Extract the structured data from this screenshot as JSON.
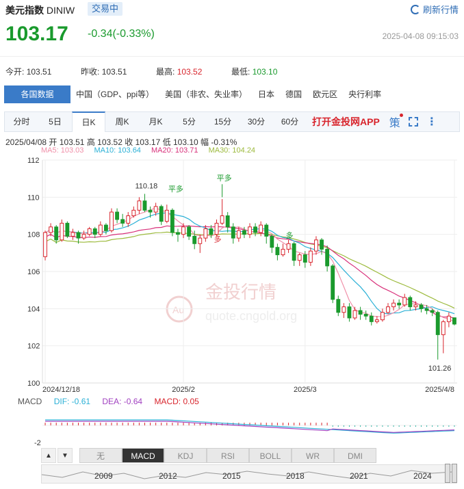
{
  "header": {
    "name": "美元指数",
    "code": "DINIW",
    "status_badge": "交易中",
    "refresh_label": "刷新行情",
    "price": "103.17",
    "change": "-0.34(-0.33%)",
    "timestamp": "2025-04-08 09:15:03"
  },
  "quote": {
    "open_label": "今开:",
    "open": "103.51",
    "prev_close_label": "昨收:",
    "prev_close": "103.51",
    "high_label": "最高:",
    "high": "103.52",
    "low_label": "最低:",
    "low": "103.10"
  },
  "data_tabs": [
    "各国数据",
    "中国（GDP、ppi等）",
    "美国（非农、失业率）",
    "日本",
    "德国",
    "欧元区",
    "央行利率"
  ],
  "period_tabs": [
    "分时",
    "5日",
    "日K",
    "周K",
    "月K",
    "5分",
    "15分",
    "30分",
    "60分"
  ],
  "period_active": "日K",
  "app_link": "打开金投网APP",
  "ce_icon_label": "策",
  "ohlc_line": {
    "date": "2025/04/08",
    "open_label": "开",
    "open": "103.51",
    "high_label": "高",
    "high": "103.52",
    "close_label": "收",
    "close": "103.17",
    "low_label": "低",
    "low": "103.10",
    "amp_label": "幅",
    "amp": "-0.31%"
  },
  "ma_legend": [
    {
      "label": "MA5: 103.03",
      "color": "#f08fa8"
    },
    {
      "label": "MA10: 103.64",
      "color": "#2ab0d6"
    },
    {
      "label": "MA20: 103.71",
      "color": "#d8307a"
    },
    {
      "label": "MA30: 104.24",
      "color": "#9cba3c"
    }
  ],
  "watermark": {
    "cn": "金投行情",
    "url": "quote.cngold.org",
    "logo": "Au"
  },
  "macd_legend": {
    "name": "MACD",
    "dif": "DIF: -0.61",
    "dea": "DEA: -0.64",
    "macd": "MACD: 0.05"
  },
  "indicator_tabs": [
    "无",
    "MACD",
    "KDJ",
    "RSI",
    "BOLL",
    "WR",
    "DMI"
  ],
  "indicator_active": "MACD",
  "navigator_years": [
    "2009",
    "2012",
    "2015",
    "2018",
    "2021",
    "2024"
  ],
  "colors": {
    "up": "#d8242c",
    "down": "#1a9a2d",
    "accent": "#3a7bc8"
  },
  "chart_data": {
    "type": "candlestick",
    "title": "美元指数 DINIW 日K",
    "y_ticks": [
      "112",
      "110",
      "108",
      "106",
      "104",
      "102",
      "100"
    ],
    "ylim": [
      100,
      112
    ],
    "x_tick_labels": [
      "2024/12/18",
      "2025/2",
      "2025/3",
      "2025/4/8"
    ],
    "annotations": [
      {
        "text": "110.18",
        "value": 110.18,
        "kind": "high"
      },
      {
        "text": "101.26",
        "value": 101.26,
        "kind": "low"
      },
      {
        "text": "平多",
        "kind": "signal"
      },
      {
        "text": "平多",
        "kind": "signal"
      },
      {
        "text": "多",
        "kind": "signal"
      },
      {
        "text": "多",
        "kind": "signal"
      }
    ],
    "candles": [
      [
        106.8,
        108.1,
        108.2,
        106.6
      ],
      [
        108.1,
        108.4,
        108.6,
        107.9
      ],
      [
        108.4,
        107.7,
        108.5,
        107.5
      ],
      [
        107.7,
        108.6,
        108.8,
        107.6
      ],
      [
        108.6,
        107.9,
        108.7,
        107.8
      ],
      [
        107.9,
        108.1,
        108.3,
        107.7
      ],
      [
        108.1,
        107.8,
        108.2,
        107.5
      ],
      [
        107.8,
        108.0,
        108.2,
        107.7
      ],
      [
        108.0,
        108.3,
        108.4,
        107.9
      ],
      [
        108.3,
        108.0,
        108.4,
        107.8
      ],
      [
        108.0,
        108.5,
        108.7,
        107.9
      ],
      [
        108.5,
        108.2,
        108.6,
        108.0
      ],
      [
        108.2,
        109.2,
        109.4,
        108.1
      ],
      [
        109.2,
        108.8,
        109.4,
        108.6
      ],
      [
        108.8,
        108.6,
        109.1,
        108.4
      ],
      [
        108.6,
        109.0,
        109.2,
        108.4
      ],
      [
        109.0,
        109.3,
        109.5,
        108.9
      ],
      [
        109.3,
        109.8,
        110.0,
        109.1
      ],
      [
        109.8,
        109.3,
        110.18,
        109.2
      ],
      [
        109.3,
        109.2,
        109.5,
        108.9
      ],
      [
        109.2,
        109.5,
        109.7,
        109.0
      ],
      [
        109.5,
        108.7,
        109.6,
        108.5
      ],
      [
        108.7,
        109.3,
        109.6,
        108.6
      ],
      [
        109.3,
        108.1,
        109.4,
        107.9
      ],
      [
        108.1,
        108.0,
        108.3,
        107.6
      ],
      [
        108.0,
        108.4,
        108.6,
        107.8
      ],
      [
        108.4,
        107.9,
        108.5,
        107.7
      ],
      [
        107.9,
        107.5,
        108.2,
        107.2
      ],
      [
        107.5,
        107.8,
        108.0,
        107.0
      ],
      [
        107.8,
        108.3,
        108.5,
        107.6
      ],
      [
        108.3,
        108.0,
        108.5,
        107.8
      ],
      [
        108.0,
        108.6,
        108.8,
        107.9
      ],
      [
        108.6,
        109.0,
        109.9,
        108.5
      ],
      [
        109.0,
        108.4,
        109.2,
        108.1
      ],
      [
        108.4,
        107.8,
        108.6,
        107.5
      ],
      [
        107.8,
        108.2,
        108.4,
        107.6
      ],
      [
        108.2,
        108.0,
        108.4,
        107.8
      ],
      [
        108.0,
        108.4,
        108.6,
        107.8
      ],
      [
        108.4,
        108.1,
        108.6,
        107.9
      ],
      [
        108.1,
        108.5,
        108.7,
        107.9
      ],
      [
        108.5,
        107.9,
        108.6,
        107.5
      ],
      [
        107.9,
        107.3,
        108.0,
        107.0
      ],
      [
        107.3,
        106.9,
        107.5,
        106.6
      ],
      [
        106.9,
        107.2,
        107.5,
        106.8
      ],
      [
        107.2,
        107.5,
        107.7,
        107.0
      ],
      [
        107.5,
        106.6,
        107.6,
        106.3
      ],
      [
        106.6,
        106.9,
        107.0,
        106.3
      ],
      [
        106.9,
        106.5,
        107.1,
        106.2
      ],
      [
        106.5,
        107.1,
        107.3,
        106.3
      ],
      [
        107.1,
        107.7,
        107.9,
        106.9
      ],
      [
        107.7,
        107.2,
        107.8,
        106.9
      ],
      [
        107.2,
        106.3,
        107.4,
        106.0
      ],
      [
        106.3,
        104.5,
        106.4,
        104.3
      ],
      [
        104.5,
        103.8,
        104.7,
        103.6
      ],
      [
        103.8,
        104.1,
        104.3,
        103.5
      ],
      [
        104.1,
        103.5,
        104.3,
        103.3
      ],
      [
        103.5,
        103.9,
        104.1,
        103.4
      ],
      [
        103.9,
        103.7,
        104.1,
        103.4
      ],
      [
        103.7,
        103.6,
        103.9,
        103.4
      ],
      [
        103.6,
        103.3,
        103.8,
        103.1
      ],
      [
        103.3,
        103.4,
        103.6,
        103.2
      ],
      [
        103.4,
        103.8,
        104.0,
        103.3
      ],
      [
        103.8,
        104.1,
        104.3,
        103.7
      ],
      [
        104.1,
        104.3,
        104.5,
        103.9
      ],
      [
        104.3,
        104.2,
        104.5,
        104.0
      ],
      [
        104.2,
        104.6,
        104.8,
        104.1
      ],
      [
        104.6,
        104.1,
        104.7,
        103.9
      ],
      [
        104.1,
        104.2,
        104.4,
        103.9
      ],
      [
        104.2,
        104.0,
        104.3,
        103.8
      ],
      [
        104.0,
        103.9,
        104.2,
        103.7
      ],
      [
        103.9,
        103.8,
        104.0,
        103.6
      ],
      [
        103.8,
        102.6,
        103.9,
        101.26
      ],
      [
        102.6,
        103.3,
        103.4,
        101.6
      ],
      [
        103.3,
        103.6,
        103.8,
        103.0
      ],
      [
        103.51,
        103.17,
        103.52,
        103.1
      ]
    ]
  }
}
